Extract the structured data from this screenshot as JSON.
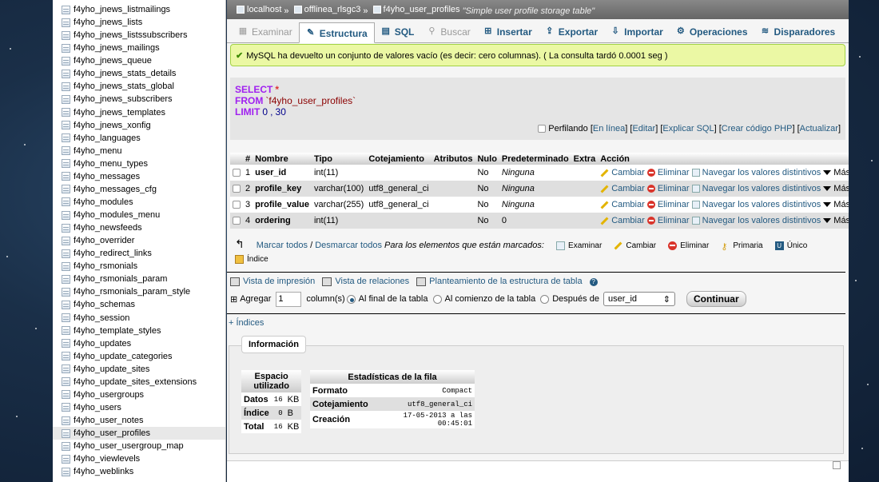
{
  "sidebar": {
    "tables": [
      "f4yho_jnews_listmailings",
      "f4yho_jnews_lists",
      "f4yho_jnews_listssubscribers",
      "f4yho_jnews_mailings",
      "f4yho_jnews_queue",
      "f4yho_jnews_stats_details",
      "f4yho_jnews_stats_global",
      "f4yho_jnews_subscribers",
      "f4yho_jnews_templates",
      "f4yho_jnews_xonfig",
      "f4yho_languages",
      "f4yho_menu",
      "f4yho_menu_types",
      "f4yho_messages",
      "f4yho_messages_cfg",
      "f4yho_modules",
      "f4yho_modules_menu",
      "f4yho_newsfeeds",
      "f4yho_overrider",
      "f4yho_redirect_links",
      "f4yho_rsmonials",
      "f4yho_rsmonials_param",
      "f4yho_rsmonials_param_style",
      "f4yho_schemas",
      "f4yho_session",
      "f4yho_template_styles",
      "f4yho_updates",
      "f4yho_update_categories",
      "f4yho_update_sites",
      "f4yho_update_sites_extensions",
      "f4yho_usergroups",
      "f4yho_users",
      "f4yho_user_notes",
      "f4yho_user_profiles",
      "f4yho_user_usergroup_map",
      "f4yho_viewlevels",
      "f4yho_weblinks"
    ],
    "active": "f4yho_user_profiles"
  },
  "breadcrumb": {
    "server": "localhost",
    "database": "offlinea_rlsgc3",
    "table": "f4yho_user_profiles",
    "description": "\"Simple user profile storage table\""
  },
  "tabs": [
    {
      "label": "Examinar",
      "icon": "browse-icon",
      "state": "disabled"
    },
    {
      "label": "Estructura",
      "icon": "structure-icon",
      "state": "active"
    },
    {
      "label": "SQL",
      "icon": "sql-icon",
      "state": "normal"
    },
    {
      "label": "Buscar",
      "icon": "search-icon",
      "state": "disabled"
    },
    {
      "label": "Insertar",
      "icon": "insert-icon",
      "state": "normal"
    },
    {
      "label": "Exportar",
      "icon": "export-icon",
      "state": "normal"
    },
    {
      "label": "Importar",
      "icon": "import-icon",
      "state": "normal"
    },
    {
      "label": "Operaciones",
      "icon": "operations-icon",
      "state": "normal"
    },
    {
      "label": "Disparadores",
      "icon": "triggers-icon",
      "state": "normal"
    }
  ],
  "success_message": "MySQL ha devuelto un conjunto de valores vacío (es decir: cero columnas). ( La consulta tardó 0.0001 seg )",
  "sql": {
    "select_kw": "SELECT",
    "star": "*",
    "from_kw": "FROM",
    "table": "`f4yho_user_profiles`",
    "limit_kw": "LIMIT",
    "limit_a": "0",
    "limit_sep": ",",
    "limit_b": "30",
    "profiling_label": "Perfilando",
    "links": [
      "En línea",
      "Editar",
      "Explicar SQL",
      "Crear código PHP",
      "Actualizar"
    ]
  },
  "structure": {
    "headers": [
      "#",
      "Nombre",
      "Tipo",
      "Cotejamiento",
      "Atributos",
      "Nulo",
      "Predeterminado",
      "Extra",
      "Acción"
    ],
    "rows": [
      {
        "n": "1",
        "name": "user_id",
        "type": "int(11)",
        "collation": "",
        "attributes": "",
        "null": "No",
        "default": "Ninguna",
        "extra": ""
      },
      {
        "n": "2",
        "name": "profile_key",
        "type": "varchar(100)",
        "collation": "utf8_general_ci",
        "attributes": "",
        "null": "No",
        "default": "Ninguna",
        "extra": ""
      },
      {
        "n": "3",
        "name": "profile_value",
        "type": "varchar(255)",
        "collation": "utf8_general_ci",
        "attributes": "",
        "null": "No",
        "default": "Ninguna",
        "extra": ""
      },
      {
        "n": "4",
        "name": "ordering",
        "type": "int(11)",
        "collation": "",
        "attributes": "",
        "null": "No",
        "default": "0",
        "extra": ""
      }
    ],
    "actions": {
      "change": "Cambiar",
      "drop": "Eliminar",
      "distinct": "Navegar los valores distintivos",
      "more": "Más"
    }
  },
  "mark": {
    "check_all": "Marcar todos",
    "sep": "/",
    "uncheck_all": "Desmarcar todos",
    "with_selected": "Para los elementos que están marcados:",
    "browse": "Examinar",
    "change": "Cambiar",
    "drop": "Eliminar",
    "primary": "Primaria",
    "unique": "Único",
    "index": "Índice"
  },
  "print_links": [
    "Vista de impresión",
    "Vista de relaciones",
    "Planteamiento de la estructura de tabla"
  ],
  "add_column": {
    "label": "Agregar",
    "count": "1",
    "suffix": "column(s)",
    "opt_end": "Al final de la tabla",
    "opt_start": "Al comienzo de la tabla",
    "opt_after": "Después de",
    "after_field": "user_id",
    "button": "Continuar"
  },
  "indices_link": "+ Índices",
  "info": {
    "legend": "Información",
    "space": {
      "header": "Espacio utilizado",
      "rows": [
        {
          "label": "Datos",
          "value": "16",
          "unit": "KB"
        },
        {
          "label": "Índice",
          "value": "0",
          "unit": "B"
        },
        {
          "label": "Total",
          "value": "16",
          "unit": "KB"
        }
      ]
    },
    "stats": {
      "header": "Estadísticas de la fila",
      "rows": [
        {
          "label": "Formato",
          "value": "Compact"
        },
        {
          "label": "Cotejamiento",
          "value": "utf8_general_ci"
        },
        {
          "label": "Creación",
          "value": "17-05-2013 a las 00:45:01"
        }
      ]
    }
  },
  "colors": {
    "link": "#235a81",
    "success_bg": "#ebf8a4",
    "keyword": "#a020f0"
  }
}
